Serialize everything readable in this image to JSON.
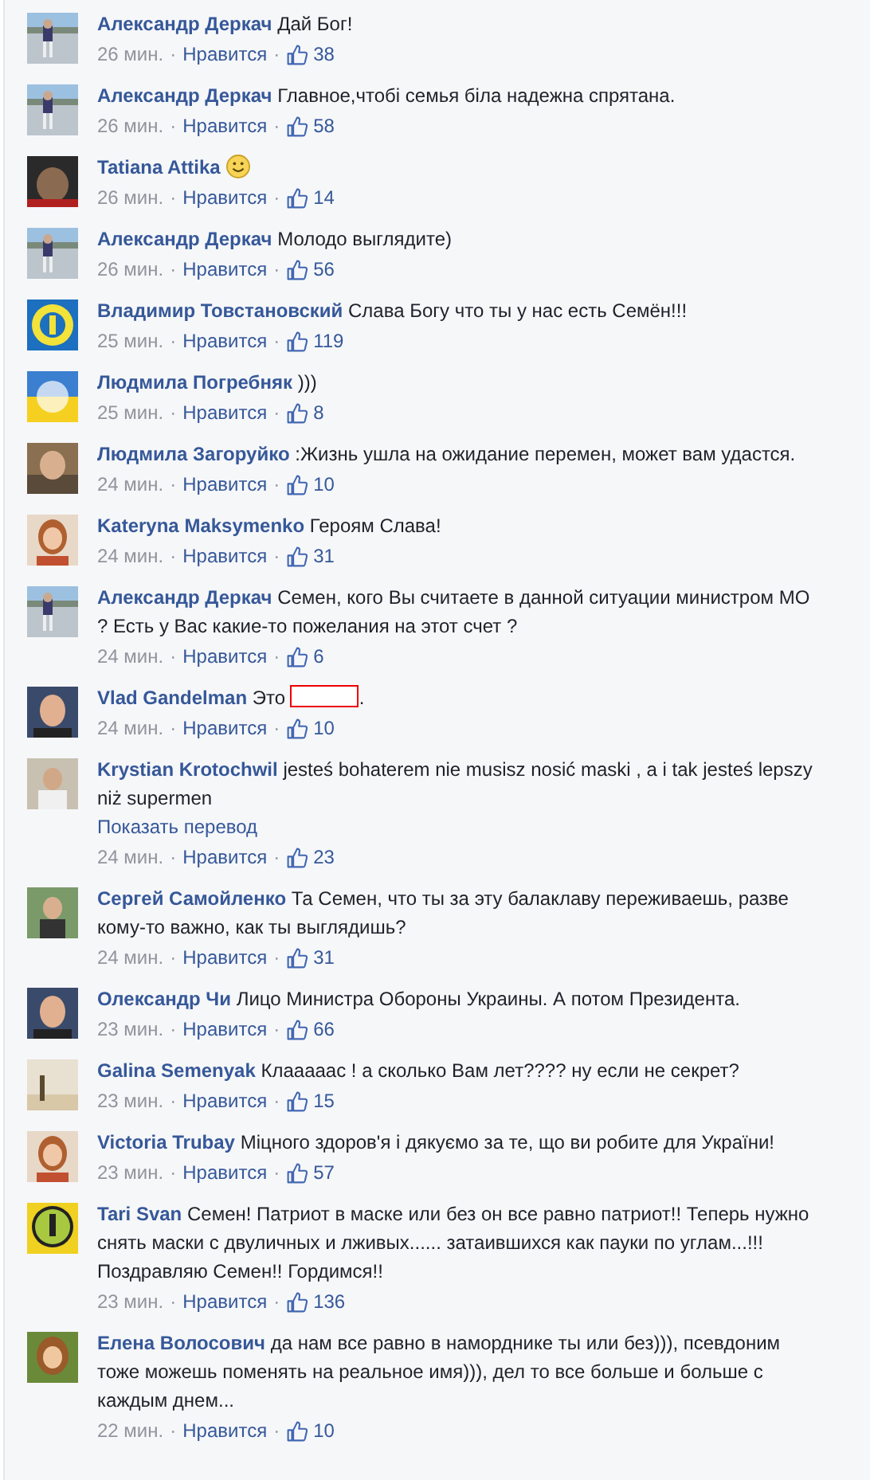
{
  "comments": [
    {
      "author": "Александр Деркач",
      "text": "Дай Бог!",
      "time": "26 мин.",
      "seps": [
        "·",
        "·"
      ],
      "like_label": "Нравится",
      "likes": "38"
    },
    {
      "author": "Александр Деркач",
      "text": "Главное,чтобі семья біла надежна спрятана.",
      "time": "26 мин.",
      "seps": [
        "·",
        "·"
      ],
      "like_label": "Нравится",
      "likes": "58"
    },
    {
      "author": "Tatiana Attika",
      "emoji": true,
      "time": "26 мин.",
      "seps": [
        "·",
        "·"
      ],
      "like_label": "Нравится",
      "likes": "14"
    },
    {
      "author": "Александр Деркач",
      "text": "Молодо выглядите)",
      "time": "26 мин.",
      "seps": [
        "·",
        "·"
      ],
      "like_label": "Нравится",
      "likes": "56"
    },
    {
      "author": "Владимир Товстановский",
      "text": "Слава Богу что ты у нас есть Семён!!!",
      "time": "25 мин.",
      "seps": [
        "·",
        "·"
      ],
      "like_label": "Нравится",
      "likes": "119"
    },
    {
      "author": "Людмила Погребняк",
      "text": ")))",
      "time": "25 мин.",
      "seps": [
        "·",
        "·"
      ],
      "like_label": "Нравится",
      "likes": "8"
    },
    {
      "author": "Людмила Загоруйко",
      "text": ":Жизнь ушла на ожидание перемен, может вам удастся.",
      "time": "24 мин.",
      "seps": [
        "·",
        "·"
      ],
      "like_label": "Нравится",
      "likes": "10"
    },
    {
      "author": "Kateryna Maksymenko",
      "text": "Героям Слава!",
      "time": "24 мин.",
      "seps": [
        "·",
        "·"
      ],
      "like_label": "Нравится",
      "likes": "31"
    },
    {
      "author": "Александр Деркач",
      "text": "Семен, кого Вы считаете в данной ситуации министром МО ? Есть у Вас какие-то пожелания на этот счет ?",
      "time": "24 мин.",
      "seps": [
        "·",
        "·"
      ],
      "like_label": "Нравится",
      "likes": "6"
    },
    {
      "author": "Vlad Gandelman",
      "text": "Это",
      "redacted": true,
      "text_end": ".",
      "time": "24 мин.",
      "seps": [
        "·",
        "·"
      ],
      "like_label": "Нравится",
      "likes": "10"
    },
    {
      "author": "Krystian Krotochwil",
      "text": "jesteś bohaterem nie musisz nosić maski , a i tak jesteś lepszy niż supermen",
      "translation_link": "Показать перевод",
      "time": "24 мин.",
      "seps": [
        "·",
        "·"
      ],
      "like_label": "Нравится",
      "likes": "23"
    },
    {
      "author": "Сергей Самойленко",
      "text": "Та Семен, что ты за эту балаклаву переживаешь, разве кому-то важно, как ты выглядишь?",
      "time": "24 мин.",
      "seps": [
        "·",
        "·"
      ],
      "like_label": "Нравится",
      "likes": "31"
    },
    {
      "author": "Олександр Чи",
      "text": "Лицо Министра Обороны Украины. А потом Президента.",
      "time": "23 мин.",
      "seps": [
        "·",
        "·"
      ],
      "like_label": "Нравится",
      "likes": "66"
    },
    {
      "author": "Galina Semenyak",
      "text": "Клаааaас ! а сколько Вам лет???? ну если не секрет?",
      "time": "23 мин.",
      "seps": [
        "·",
        "·"
      ],
      "like_label": "Нравится",
      "likes": "15"
    },
    {
      "author": "Victoria Trubay",
      "text": "Міцного здоров'я і дякуємо за те, що ви робите для України!",
      "time": "23 мин.",
      "seps": [
        "·",
        "·"
      ],
      "like_label": "Нравится",
      "likes": "57"
    },
    {
      "author": "Tari Svan",
      "text": "Семен! Патриот в маске или без он все равно патриот!! Теперь нужно снять маски с двуличных и лживых...... затаившихся как пауки по углам...!!! Поздравляю Семен!! Гордимся!!",
      "time": "23 мин.",
      "seps": [
        "·",
        "·"
      ],
      "like_label": "Нравится",
      "likes": "136"
    },
    {
      "author": "Елена Волосович",
      "text": "да нам все равно в наморднике ты или без))), псевдоним тоже можешь поменять на реальное имя))), дел то все больше и больше с каждым днем...",
      "time": "22 мин.",
      "seps": [
        "·",
        "·"
      ],
      "like_label": "Нравится",
      "likes": "10"
    }
  ]
}
